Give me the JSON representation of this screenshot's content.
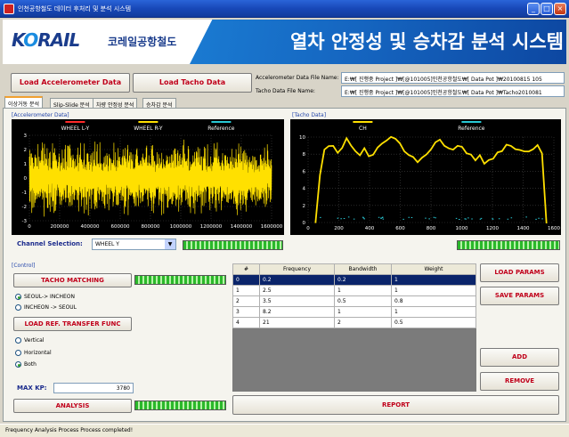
{
  "window": {
    "title": "인천공항철도 데이터 후처리 및 분석 시스템"
  },
  "header": {
    "logo_text_a": "K",
    "logo_text_b": "RAIL",
    "logo_korean": "코레일공항철도",
    "banner_title": "열차 안정성 및 승차감 분석 시스템"
  },
  "load": {
    "accel_button": "Load Accelerometer Data",
    "tacho_button": "Load Tacho Data",
    "accel_file_label": "Accelerometer Data File Name:",
    "accel_file_value": "E:₩[ 진행중 Project ]₩[@101005]인천공항철도₩[ Data Pot ]₩20100815 105",
    "tacho_file_label": "Tacho Data File Name:",
    "tacho_file_value": "E:₩[ 진행중 Project ]₩[@101005]인천공항철도₩[ Data Pot ]₩Tacho2010081"
  },
  "tabs": [
    "이상거동 분석",
    "Slip-Slide 분석",
    "차량 안정성 분석",
    "승차감 분석"
  ],
  "accel_chart": {
    "group_label": "[Accelerometer Data]",
    "legend": [
      {
        "name": "WHEEL L-Y",
        "color": "#ff2a2a"
      },
      {
        "name": "WHEEL R-Y",
        "color": "#ffe000"
      },
      {
        "name": "Reference",
        "color": "#29c9d6"
      }
    ],
    "y_ticks": [
      "3",
      "2",
      "1",
      "0",
      "-1",
      "-2",
      "-3"
    ],
    "x_ticks": [
      "0",
      "200000",
      "400000",
      "600000",
      "800000",
      "1000000",
      "1200000",
      "1400000",
      "1600000"
    ]
  },
  "tacho_chart": {
    "group_label": "[Tacho Data]",
    "legend": [
      {
        "name": "CH",
        "color": "#ffe000"
      },
      {
        "name": "Reference",
        "color": "#29c9d6"
      }
    ],
    "y_ticks": [
      "10",
      "8",
      "6",
      "4",
      "2",
      "0"
    ],
    "x_ticks": [
      "0",
      "200",
      "400",
      "600",
      "800",
      "1000",
      "1200",
      "1400",
      "1600"
    ]
  },
  "channel": {
    "label": "Channel Selection:",
    "value": "WHEEL Y"
  },
  "control": {
    "group_label": "[Control]",
    "tacho_matching": "TACHO MATCHING",
    "direction_options": [
      "SEOUL-> INCHEON",
      "INCHEON -> SEOUL"
    ],
    "direction_selected": 0,
    "load_ref": "LOAD REF. TRANSFER FUNC",
    "axis_options": [
      "Vertical",
      "Horizontal",
      "Both"
    ],
    "axis_selected": 2,
    "max_kp_label": "MAX KP:",
    "max_kp_value": "3780",
    "analysis": "ANALYSIS"
  },
  "params": {
    "columns": [
      "#",
      "Frequency",
      "Bandwidth",
      "Weight"
    ],
    "rows": [
      [
        "0",
        "0.2",
        "0.2",
        "1"
      ],
      [
        "1",
        "2.5",
        "1",
        "1"
      ],
      [
        "2",
        "3.5",
        "0.5",
        "0.8"
      ],
      [
        "3",
        "8.2",
        "1",
        "1"
      ],
      [
        "4",
        "21",
        "2",
        "0.5"
      ]
    ],
    "selected_row": 0,
    "load_params": "LOAD  PARAMS",
    "save_params": "SAVE  PARAMS",
    "add": "ADD",
    "remove": "REMOVE",
    "report": "REPORT"
  },
  "status": {
    "text": "Frequency Analysis Process Process completed!"
  }
}
